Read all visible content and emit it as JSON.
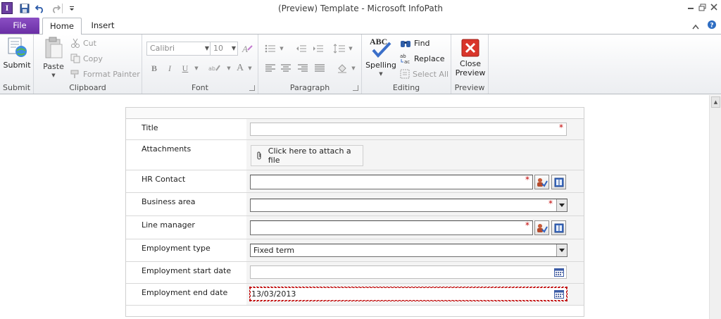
{
  "window": {
    "title": "(Preview) Template  -  Microsoft InfoPath",
    "app_icon_letter": "I"
  },
  "tabs": {
    "file": "File",
    "home": "Home",
    "insert": "Insert"
  },
  "ribbon": {
    "submit": {
      "label": "Submit",
      "button": "Submit"
    },
    "clipboard": {
      "label": "Clipboard",
      "paste": "Paste",
      "cut": "Cut",
      "copy": "Copy",
      "format_painter": "Format Painter"
    },
    "font": {
      "label": "Font",
      "font_name": "Calibri",
      "font_size": "10"
    },
    "paragraph": {
      "label": "Paragraph"
    },
    "editing": {
      "label": "Editing",
      "spelling": "Spelling",
      "find": "Find",
      "replace": "Replace",
      "select_all": "Select All",
      "abc": "ABC"
    },
    "preview": {
      "label": "Preview",
      "close_line1": "Close",
      "close_line2": "Preview"
    }
  },
  "form": {
    "title_label": "Title",
    "title_value": "",
    "attachments_label": "Attachments",
    "attach_text": "Click here to attach a file",
    "hr_contact_label": "HR Contact",
    "hr_contact_value": "",
    "business_area_label": "Business area",
    "business_area_value": "",
    "line_manager_label": "Line manager",
    "line_manager_value": "",
    "employment_type_label": "Employment type",
    "employment_type_value": "Fixed term",
    "start_date_label": "Employment start date",
    "start_date_value": "",
    "end_date_label": "Employment end date",
    "end_date_value": "13/03/2013",
    "required_mark": "*"
  }
}
